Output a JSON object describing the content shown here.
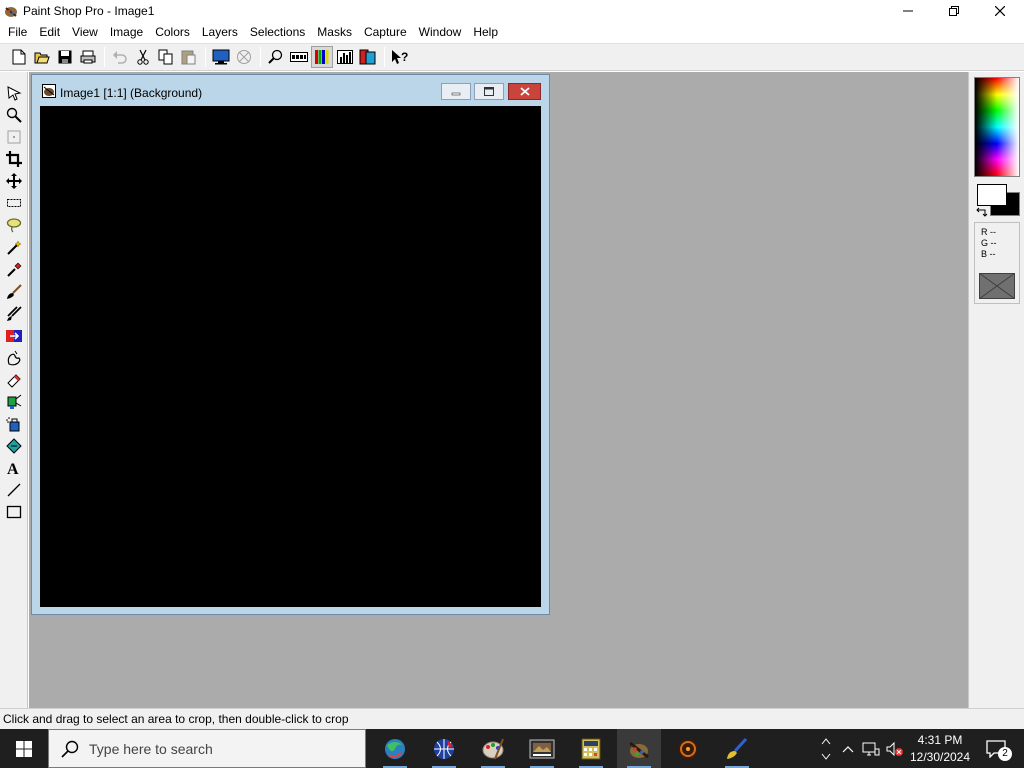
{
  "window": {
    "title": "Paint Shop Pro - Image1",
    "controls": {
      "minimize": "minimize",
      "restore": "restore",
      "close": "close"
    }
  },
  "menu": [
    "File",
    "Edit",
    "View",
    "Image",
    "Colors",
    "Layers",
    "Selections",
    "Masks",
    "Capture",
    "Window",
    "Help"
  ],
  "toolbar": {
    "buttons": [
      "new-icon",
      "open-icon",
      "save-icon",
      "print-icon",
      "undo-icon",
      "cut-icon",
      "copy-icon",
      "paste-icon",
      "full-screen-preview-icon",
      "normal-viewing-icon",
      "zoom-icon",
      "toggle-toolbar-icon",
      "toggle-palette-icon",
      "histogram-icon",
      "layer-palette-icon",
      "context-help-icon"
    ]
  },
  "tools": [
    "arrow-tool-icon",
    "zoom-tool-icon",
    "deformation-tool-icon",
    "crop-tool-icon",
    "mover-tool-icon",
    "selection-tool-icon",
    "freehand-tool-icon",
    "magic-wand-tool-icon",
    "dropper-tool-icon",
    "paintbrush-tool-icon",
    "clone-brush-tool-icon",
    "color-replacer-tool-icon",
    "retouch-tool-icon",
    "eraser-tool-icon",
    "picture-tube-tool-icon",
    "airbrush-tool-icon",
    "flood-fill-tool-icon",
    "text-tool-icon",
    "line-tool-icon",
    "shape-tool-icon"
  ],
  "document": {
    "title": "Image1 [1:1] (Background)",
    "canvas_color": "#000000"
  },
  "colors": {
    "foreground": "#ffffff",
    "background": "#000000",
    "rgb": {
      "r": "R --",
      "g": "G --",
      "b": "B --"
    }
  },
  "status": "Click and drag to select an area to crop, then double-click to crop",
  "taskbar": {
    "search_placeholder": "Type here to search",
    "apps": [
      "browser-app-icon",
      "network-app-icon",
      "paint-palette-app-icon",
      "image-viewer-app-icon",
      "calculator-app-icon",
      "paint-shop-pro-app-icon",
      "disc-app-icon",
      "brush-app-icon"
    ],
    "time": "4:31 PM",
    "date": "12/30/2024",
    "notifications": "2"
  }
}
